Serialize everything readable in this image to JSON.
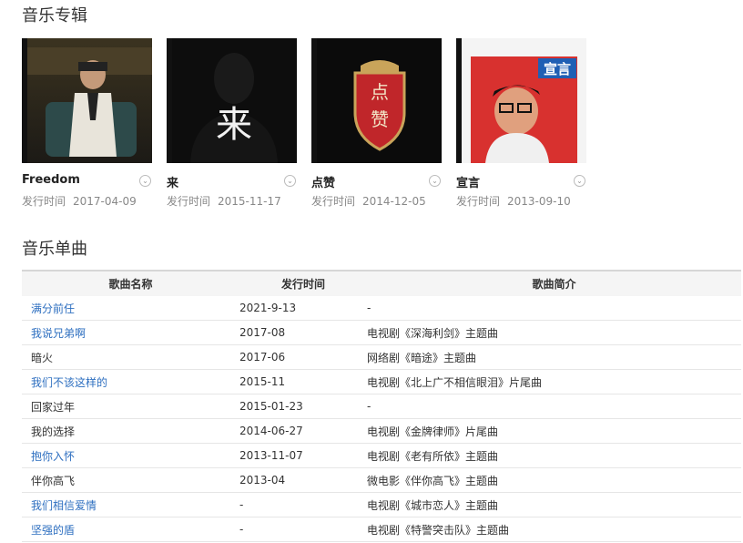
{
  "albums_section": {
    "title": "音乐专辑"
  },
  "albums": [
    {
      "name": "Freedom",
      "date_label": "发行时间",
      "date": "2017-04-09"
    },
    {
      "name": "来",
      "date_label": "发行时间",
      "date": "2015-11-17",
      "cover_text": "来"
    },
    {
      "name": "点赞",
      "date_label": "发行时间",
      "date": "2014-12-05",
      "cover_text_top": "点",
      "cover_text_bottom": "赞"
    },
    {
      "name": "宣言",
      "date_label": "发行时间",
      "date": "2013-09-10",
      "cover_text": "宣言"
    }
  ],
  "singles_section": {
    "title": "音乐单曲"
  },
  "table": {
    "headers": [
      "歌曲名称",
      "发行时间",
      "歌曲简介"
    ],
    "rows": [
      {
        "name": "满分前任",
        "date": "2021-9-13",
        "desc": "-",
        "link": true
      },
      {
        "name": "我说兄弟啊",
        "date": "2017-08",
        "desc": "电视剧《深海利剑》主题曲",
        "link": true
      },
      {
        "name": "暗火",
        "date": "2017-06",
        "desc": "网络剧《暗途》主题曲",
        "link": false
      },
      {
        "name": "我们不该这样的",
        "date": "2015-11",
        "desc": "电视剧《北上广不相信眼泪》片尾曲",
        "link": true
      },
      {
        "name": "回家过年",
        "date": "2015-01-23",
        "desc": "-",
        "link": false
      },
      {
        "name": "我的选择",
        "date": "2014-06-27",
        "desc": "电视剧《金牌律师》片尾曲",
        "link": false
      },
      {
        "name": "抱你入怀",
        "date": "2013-11-07",
        "desc": "电视剧《老有所依》主题曲",
        "link": true
      },
      {
        "name": "伴你高飞",
        "date": "2013-04",
        "desc": "微电影《伴你高飞》主题曲",
        "link": false
      },
      {
        "name": "我们相信爱情",
        "date": "-",
        "desc": "电视剧《城市恋人》主题曲",
        "link": true
      },
      {
        "name": "坚强的盾",
        "date": "-",
        "desc": "电视剧《特警突击队》主题曲",
        "link": true
      }
    ]
  },
  "icons": {
    "album_toggle": "chevron-down-icon"
  },
  "colors": {
    "link": "#2e6fc0",
    "header_bg": "#f5f5f5"
  }
}
